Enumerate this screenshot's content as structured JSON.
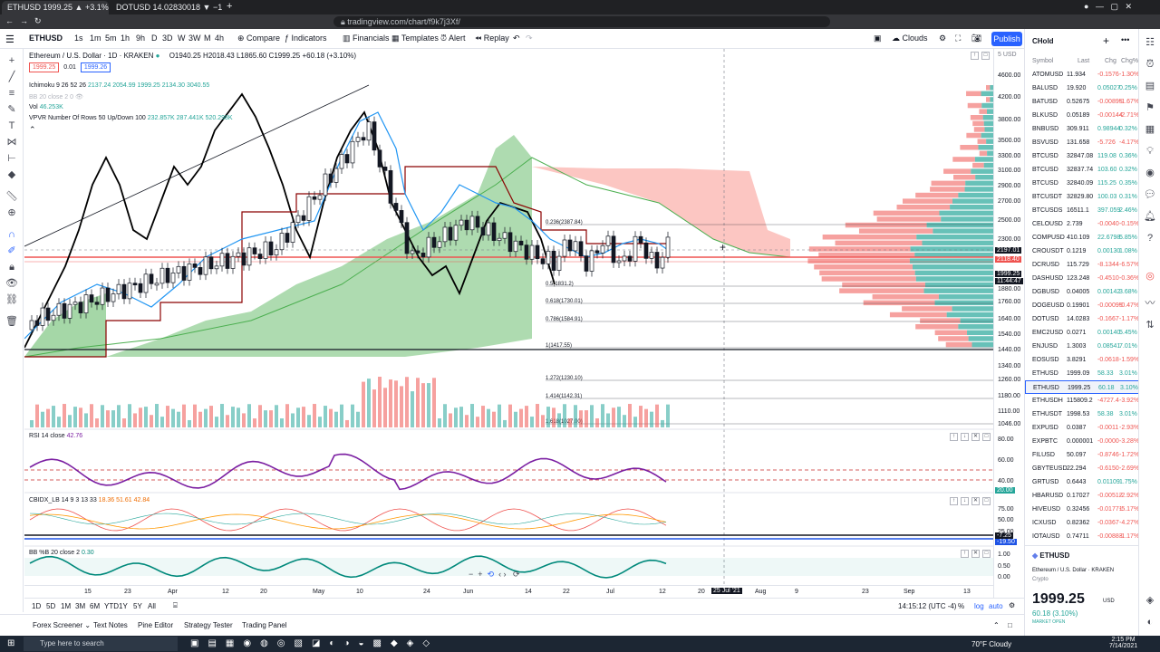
{
  "browser": {
    "tabs": [
      {
        "label": "ETHUSD 1999.25 ▲ +3.1% Clouds",
        "active": true
      },
      {
        "label": "DOTUSD 14.02830018 ▼ −1.17% poi",
        "active": false
      }
    ],
    "new_tab": "+",
    "url": "tradingview.com/chart/f9k7j3Xf/"
  },
  "toolbar": {
    "symbol": "ETHUSD",
    "intervals": [
      "1s",
      "1m",
      "5m",
      "1h",
      "9h",
      "D",
      "3D",
      "W",
      "3W",
      "M",
      "4h"
    ],
    "compare": "Compare",
    "indicators": "Indicators",
    "financials": "Financials",
    "templates": "Templates",
    "alert": "Alert",
    "replay": "Replay",
    "layout_name": "Clouds",
    "publish": "Publish"
  },
  "legend": {
    "title": "Ethereum / U.S. Dollar · 1D · KRAKEN",
    "ohlc": "O1940.25 H2018.43 L1865.60 C1999.25 +60.18 (+3.10%)",
    "bid": "1999.25",
    "spread": "0.01",
    "ask": "1999.26",
    "ichimoku": "Ichimoku 9 26 52 26",
    "ichimoku_vals": "2137.24 2054.99 1999.25 2134.30 3040.55",
    "bb": "BB 20 close 2 0",
    "vol": "Vol",
    "vol_val": "46.253K",
    "vpvr": "VPVR Number Of Rows 50 Up/Down 100",
    "vpvr_vals": "232.857K 287.441K 520.298K"
  },
  "fib_levels": [
    {
      "label": "0.236(2387.84)",
      "price": 2387.84
    },
    {
      "label": "0.5(1831.2)",
      "price": 1831.2
    },
    {
      "label": "0.618(1730.01)",
      "price": 1730.01
    },
    {
      "label": "0.786(1584.91)",
      "price": 1584.91
    },
    {
      "label": "1(1417.55)",
      "price": 1417.55
    },
    {
      "label": "1.272(1230.10)",
      "price": 1230.1
    },
    {
      "label": "1.414(1142.31)",
      "price": 1142.31
    },
    {
      "label": "1.618(1027.00)",
      "price": 1027.0
    }
  ],
  "price_scale": [
    "4600.00",
    "4200.00",
    "3800.00",
    "3500.00",
    "3300.00",
    "3100.00",
    "2900.00",
    "2700.00",
    "2500.00",
    "2300.00",
    "2197.01",
    "2118.40",
    "1999.25",
    "1880.00",
    "1760.00",
    "1640.00",
    "1540.00",
    "1440.00",
    "1340.00",
    "1260.00",
    "1180.00",
    "1110.00",
    "1046.00"
  ],
  "price_scale_unit": "5 USD",
  "price_tags": {
    "crosshair": "2197.01",
    "red": "2118.40",
    "last": "1999.25",
    "countdown": "11:44:47"
  },
  "rsi": {
    "legend": "RSI 14 close",
    "value": "42.76",
    "scale": [
      "80.00",
      "60.00",
      "40.00",
      "20.00"
    ],
    "tag": "20.00"
  },
  "cbidx": {
    "legend": "CBIDX_LB 14 9 3 13 33",
    "values": "18.36 51.61 42.84",
    "scale": [
      "75.00",
      "50.00",
      "25.00"
    ],
    "tag1": "-7.25",
    "tag2": "-19.50"
  },
  "bbb": {
    "legend": "BB %B 20 close 2",
    "value": "0.30",
    "scale": [
      "1.00",
      "0.50",
      "0.00"
    ]
  },
  "time_axis": [
    "15",
    "23",
    "Apr",
    "12",
    "20",
    "May",
    "10",
    "24",
    "Jun",
    "14",
    "22",
    "Jul",
    "12",
    "20",
    "25 Jul '21",
    "Aug",
    "9",
    "23",
    "Sep",
    "13"
  ],
  "bottom_bar": {
    "ranges": [
      "1D",
      "5D",
      "1M",
      "3M",
      "6M",
      "YTD",
      "1Y",
      "5Y",
      "All"
    ],
    "clock": "14:15:12 (UTC -4)",
    "pct": "%",
    "log": "log",
    "auto": "auto"
  },
  "bottom_panel": [
    "Forex Screener",
    "Text Notes",
    "Pine Editor",
    "Strategy Tester",
    "Trading Panel"
  ],
  "watchlist": {
    "title": "CHold",
    "columns": [
      "Symbol",
      "Last",
      "Chg",
      "Chg%"
    ],
    "rows": [
      {
        "sym": "ATOMUSD",
        "last": "11.934",
        "chg": "-0.1576",
        "pct": "-1.30%",
        "up": false
      },
      {
        "sym": "BALUSD",
        "last": "19.920",
        "chg": "0.05027",
        "pct": "0.25%",
        "up": true
      },
      {
        "sym": "BATUSD",
        "last": "0.52675",
        "chg": "-0.00895",
        "pct": "-1.67%",
        "up": false
      },
      {
        "sym": "BLKUSD",
        "last": "0.05189",
        "chg": "-0.00144",
        "pct": "-2.71%",
        "up": false
      },
      {
        "sym": "BNBUSD",
        "last": "309.911",
        "chg": "0.98944",
        "pct": "0.32%",
        "up": true
      },
      {
        "sym": "BSVUSD",
        "last": "131.658",
        "chg": "-5.726",
        "pct": "-4.17%",
        "up": false
      },
      {
        "sym": "BTCUSD",
        "last": "32847.08",
        "chg": "119.08",
        "pct": "0.36%",
        "up": true
      },
      {
        "sym": "BTCUSD",
        "last": "32837.74",
        "chg": "103.60",
        "pct": "0.32%",
        "up": true
      },
      {
        "sym": "BTCUSD",
        "last": "32840.09",
        "chg": "115.25",
        "pct": "0.35%",
        "up": true
      },
      {
        "sym": "BTCUSDT",
        "last": "32829.80",
        "chg": "100.03",
        "pct": "0.31%",
        "up": true
      },
      {
        "sym": "BTCUSDS",
        "last": "16511.1",
        "chg": "397.059",
        "pct": "2.46%",
        "up": true
      },
      {
        "sym": "CELOUSD",
        "last": "2.739",
        "chg": "-0.0040",
        "pct": "-0.15%",
        "up": false
      },
      {
        "sym": "COMPUSD",
        "last": "410.109",
        "chg": "22.6798",
        "pct": "5.85%",
        "up": true
      },
      {
        "sym": "CROUSDT",
        "last": "0.1219",
        "chg": "0.00130",
        "pct": "1.08%",
        "up": true
      },
      {
        "sym": "DCRUSD",
        "last": "115.729",
        "chg": "-8.1344",
        "pct": "-6.57%",
        "up": false
      },
      {
        "sym": "DASHUSD",
        "last": "123.248",
        "chg": "-0.4510",
        "pct": "-0.36%",
        "up": false
      },
      {
        "sym": "DGBUSD",
        "last": "0.04005",
        "chg": "0.00142",
        "pct": "3.68%",
        "up": true
      },
      {
        "sym": "DOGEUSD",
        "last": "0.19901",
        "chg": "-0.00095",
        "pct": "-0.47%",
        "up": false
      },
      {
        "sym": "DOTUSD",
        "last": "14.0283",
        "chg": "-0.1667",
        "pct": "-1.17%",
        "up": false
      },
      {
        "sym": "EMC2USD",
        "last": "0.0271",
        "chg": "0.00140",
        "pct": "5.45%",
        "up": true
      },
      {
        "sym": "ENJUSD",
        "last": "1.3003",
        "chg": "0.08541",
        "pct": "7.01%",
        "up": true
      },
      {
        "sym": "EOSUSD",
        "last": "3.8291",
        "chg": "-0.0618",
        "pct": "-1.59%",
        "up": false
      },
      {
        "sym": "ETHUSD",
        "last": "1999.09",
        "chg": "58.33",
        "pct": "3.01%",
        "up": true
      },
      {
        "sym": "ETHUSD",
        "last": "1999.25",
        "chg": "60.18",
        "pct": "3.10%",
        "up": true,
        "selected": true
      },
      {
        "sym": "ETHUSDH",
        "last": "115809.2",
        "chg": "-4727.4",
        "pct": "-3.92%",
        "up": false
      },
      {
        "sym": "ETHUSDT",
        "last": "1998.53",
        "chg": "58.38",
        "pct": "3.01%",
        "up": true
      },
      {
        "sym": "EXPUSD",
        "last": "0.0387",
        "chg": "-0.0011",
        "pct": "-2.93%",
        "up": false
      },
      {
        "sym": "EXPBTC",
        "last": "0.000001",
        "chg": "-0.0000",
        "pct": "-3.28%",
        "up": false
      },
      {
        "sym": "FILUSD",
        "last": "50.097",
        "chg": "-0.8746",
        "pct": "-1.72%",
        "up": false
      },
      {
        "sym": "GBYTEUSD",
        "last": "22.294",
        "chg": "-0.6150",
        "pct": "-2.69%",
        "up": false
      },
      {
        "sym": "GRTUSD",
        "last": "0.6443",
        "chg": "0.01109",
        "pct": "1.75%",
        "up": true
      },
      {
        "sym": "HBARUSD",
        "last": "0.17027",
        "chg": "-0.00512",
        "pct": "-2.92%",
        "up": false
      },
      {
        "sym": "HIVEUSD",
        "last": "0.32456",
        "chg": "-0.01771",
        "pct": "-5.17%",
        "up": false
      },
      {
        "sym": "ICXUSD",
        "last": "0.82362",
        "chg": "-0.0367",
        "pct": "-4.27%",
        "up": false
      },
      {
        "sym": "IOTAUSD",
        "last": "0.74711",
        "chg": "-0.00883",
        "pct": "-1.17%",
        "up": false
      }
    ],
    "detail": {
      "symbol": "ETHUSD",
      "name": "Ethereum / U.S. Dollar",
      "exchange": "KRAKEN",
      "type": "Crypto",
      "price": "1999.25",
      "currency": "USD",
      "change": "60.18 (3.10%)",
      "status": "MARKET OPEN"
    }
  },
  "taskbar": {
    "search": "Type here to search",
    "weather": "70°F Cloudy",
    "time": "2:15 PM",
    "date": "7/14/2021"
  },
  "colors": {
    "up": "#26a69a",
    "down": "#ef5350",
    "accent": "#2962ff",
    "cloud_green": "#4caf50",
    "cloud_red": "#f44336",
    "rsi": "#7b1fa2",
    "bb": "#00897b"
  }
}
